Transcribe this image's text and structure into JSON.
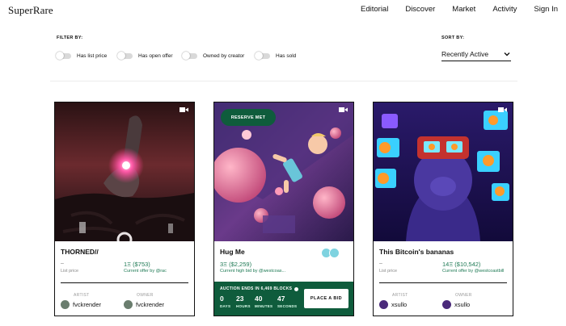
{
  "header": {
    "logo": "SuperRare",
    "nav": [
      "Editorial",
      "Discover",
      "Market",
      "Activity",
      "Sign In"
    ]
  },
  "filters": {
    "title": "FILTER BY:",
    "toggles": [
      {
        "label": "Has list price",
        "on": false
      },
      {
        "label": "Has open offer",
        "on": false
      },
      {
        "label": "Owned by creator",
        "on": false
      },
      {
        "label": "Has sold",
        "on": false
      }
    ]
  },
  "sort": {
    "title": "SORT BY:",
    "value": "Recently Active"
  },
  "cards": [
    {
      "title": "THORNED//",
      "left_price": "–",
      "left_sub": "List price",
      "right_price": "1Ξ ($753)",
      "right_sub": "Current offer by @rac",
      "artist_label": "ARTIST",
      "artist": "fvckrender",
      "owner_label": "OWNER",
      "owner": "fvckrender"
    },
    {
      "title": "Hug Me",
      "badge": "RESERVE MET",
      "price": "3Ξ ($2,259)",
      "price_sub": "Current high bid by @westcoas...",
      "auction_title": "AUCTION ENDS IN 6,469 BLOCKS",
      "countdown": [
        {
          "value": "0",
          "unit": "DAYS"
        },
        {
          "value": "23",
          "unit": "HOURS"
        },
        {
          "value": "40",
          "unit": "MINUTES"
        },
        {
          "value": "47",
          "unit": "SECONDS"
        }
      ],
      "bid_button": "PLACE A BID"
    },
    {
      "title": "This Bitcoin's bananas",
      "left_price": "–",
      "left_sub": "List price",
      "right_price": "14Ξ ($10,542)",
      "right_sub": "Current offer by @westcoastbill",
      "artist_label": "ARTIST",
      "artist": "xsullo",
      "owner_label": "OWNER",
      "owner": "xsullo"
    }
  ],
  "colors": {
    "accent_green": "#0f5c3c",
    "price_green": "#1f7a55"
  },
  "icons": [
    "video-icon",
    "chevron-down-icon",
    "info-icon"
  ]
}
